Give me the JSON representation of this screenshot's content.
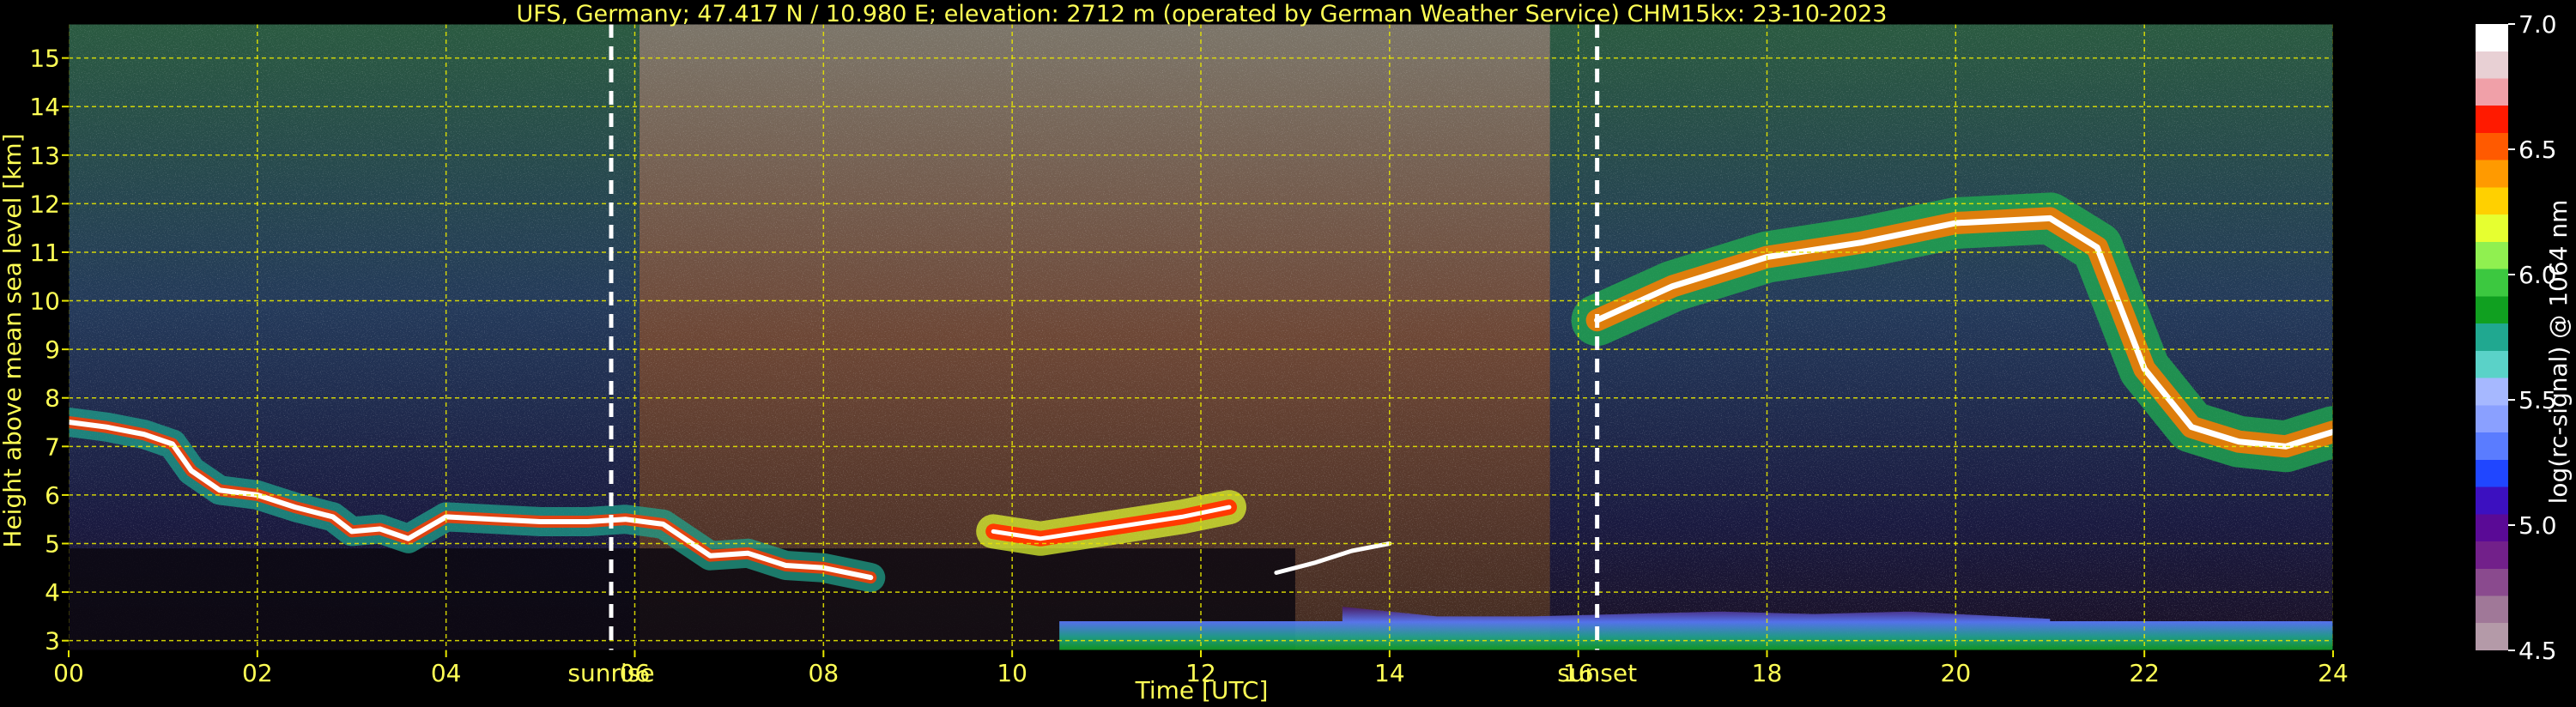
{
  "chart_data": {
    "type": "heatmap",
    "title": "UFS, Germany; 47.417 N / 10.980 E; elevation: 2712 m  (operated by German Weather Service)    CHM15kx: 23-10-2023",
    "xlabel": "Time [UTC]",
    "ylabel": "Height above mean sea level [km]",
    "xlim": [
      0,
      24
    ],
    "ylim": [
      2.8,
      15.7
    ],
    "x_ticks": [
      {
        "value": 0,
        "label": "00"
      },
      {
        "value": 2,
        "label": "02"
      },
      {
        "value": 4,
        "label": "04"
      },
      {
        "value": 6,
        "label": "06"
      },
      {
        "value": 8,
        "label": "08"
      },
      {
        "value": 10,
        "label": "10"
      },
      {
        "value": 12,
        "label": "12"
      },
      {
        "value": 14,
        "label": "14"
      },
      {
        "value": 16,
        "label": "16"
      },
      {
        "value": 18,
        "label": "18"
      },
      {
        "value": 20,
        "label": "20"
      },
      {
        "value": 22,
        "label": "22"
      },
      {
        "value": 24,
        "label": "24"
      }
    ],
    "y_ticks": [
      {
        "value": 3,
        "label": "3"
      },
      {
        "value": 4,
        "label": "4"
      },
      {
        "value": 5,
        "label": "5"
      },
      {
        "value": 6,
        "label": "6"
      },
      {
        "value": 7,
        "label": "7"
      },
      {
        "value": 8,
        "label": "8"
      },
      {
        "value": 9,
        "label": "9"
      },
      {
        "value": 10,
        "label": "10"
      },
      {
        "value": 11,
        "label": "11"
      },
      {
        "value": 12,
        "label": "12"
      },
      {
        "value": 13,
        "label": "13"
      },
      {
        "value": 14,
        "label": "14"
      },
      {
        "value": 15,
        "label": "15"
      }
    ],
    "grid": true,
    "markers": [
      {
        "label": "sunrise",
        "x": 5.75
      },
      {
        "label": "sunset",
        "x": 16.2
      }
    ],
    "colorbar": {
      "label": "log(rc-signal) @ 1064 nm",
      "range": [
        4.5,
        7.0
      ],
      "ticks": [
        {
          "value": 4.5,
          "label": "4.5"
        },
        {
          "value": 5.0,
          "label": "5.0"
        },
        {
          "value": 5.5,
          "label": "5.5"
        },
        {
          "value": 6.0,
          "label": "6.0"
        },
        {
          "value": 6.5,
          "label": "6.5"
        },
        {
          "value": 7.0,
          "label": "7.0"
        }
      ],
      "colors": [
        "#b49aa8",
        "#a07898",
        "#8a4a8e",
        "#72208a",
        "#5a0a96",
        "#3c10c0",
        "#2046ff",
        "#5a7cff",
        "#8aa0ff",
        "#a6b8ff",
        "#5ad2c8",
        "#20a890",
        "#10a020",
        "#3cc840",
        "#90f050",
        "#e6ff30",
        "#ffd000",
        "#ff9a00",
        "#ff5a00",
        "#ff1a00",
        "#f0a0a8",
        "#e8d0d4",
        "#ffffff"
      ]
    },
    "features": {
      "layer_a": [
        [
          0,
          7.5
        ],
        [
          0.4,
          7.4
        ],
        [
          0.8,
          7.25
        ],
        [
          1.1,
          7.05
        ],
        [
          1.3,
          6.5
        ],
        [
          1.6,
          6.1
        ],
        [
          2.0,
          6.0
        ],
        [
          2.4,
          5.75
        ],
        [
          2.8,
          5.55
        ],
        [
          3.0,
          5.25
        ],
        [
          3.3,
          5.3
        ],
        [
          3.6,
          5.1
        ],
        [
          4.0,
          5.55
        ],
        [
          4.5,
          5.5
        ],
        [
          5.0,
          5.45
        ],
        [
          5.5,
          5.45
        ],
        [
          5.9,
          5.5
        ],
        [
          6.3,
          5.4
        ],
        [
          6.8,
          4.75
        ],
        [
          7.2,
          4.8
        ],
        [
          7.6,
          4.55
        ],
        [
          8.0,
          4.5
        ],
        [
          8.5,
          4.3
        ]
      ],
      "layer_b": [
        [
          9.8,
          5.25
        ],
        [
          10.3,
          5.1
        ],
        [
          10.8,
          5.25
        ],
        [
          11.3,
          5.4
        ],
        [
          11.8,
          5.55
        ],
        [
          12.3,
          5.75
        ]
      ],
      "layer_c": [
        [
          12.8,
          4.4
        ],
        [
          13.2,
          4.6
        ],
        [
          13.6,
          4.85
        ],
        [
          14.0,
          5.0
        ]
      ],
      "cirrus": [
        [
          16.2,
          9.6
        ],
        [
          17.0,
          10.3
        ],
        [
          18.0,
          10.9
        ],
        [
          19.0,
          11.2
        ],
        [
          20.0,
          11.6
        ],
        [
          21.0,
          11.7
        ],
        [
          21.5,
          11.1
        ],
        [
          22.0,
          8.6
        ],
        [
          22.5,
          7.4
        ],
        [
          23.0,
          7.1
        ],
        [
          23.5,
          7.0
        ],
        [
          24.0,
          7.3
        ]
      ],
      "boundary_layer": [
        [
          13.5,
          3.7
        ],
        [
          14.5,
          3.5
        ],
        [
          15.5,
          3.5
        ],
        [
          16.5,
          3.55
        ],
        [
          17.5,
          3.6
        ],
        [
          18.5,
          3.55
        ],
        [
          19.5,
          3.6
        ],
        [
          20.5,
          3.5
        ],
        [
          21.0,
          3.45
        ]
      ]
    }
  }
}
